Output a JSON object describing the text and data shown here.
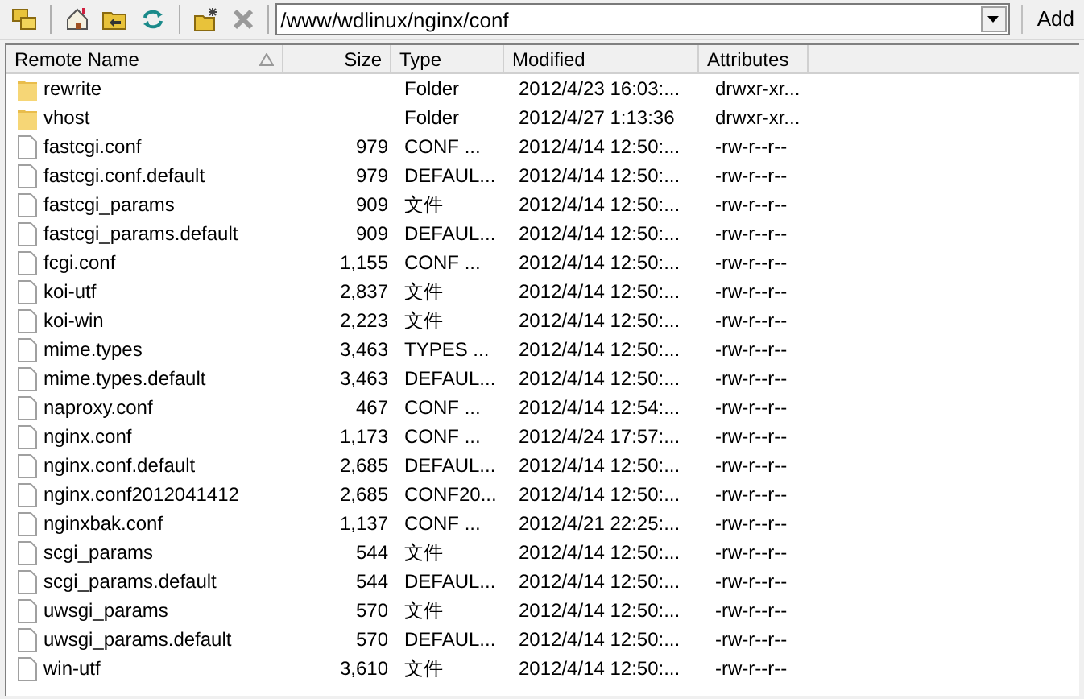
{
  "toolbar": {
    "path": "/www/wdlinux/nginx/conf",
    "add_label": "Add"
  },
  "table": {
    "columns": [
      {
        "label": "Remote Name",
        "sorted": true
      },
      {
        "label": "Size",
        "sorted": false
      },
      {
        "label": "Type",
        "sorted": false
      },
      {
        "label": "Modified",
        "sorted": false
      },
      {
        "label": "Attributes",
        "sorted": false
      }
    ],
    "rows": [
      {
        "kind": "folder",
        "name": "rewrite",
        "size": "",
        "type": "Folder",
        "modified": "2012/4/23 16:03:...",
        "attributes": "drwxr-xr..."
      },
      {
        "kind": "folder",
        "name": "vhost",
        "size": "",
        "type": "Folder",
        "modified": "2012/4/27 1:13:36",
        "attributes": "drwxr-xr..."
      },
      {
        "kind": "file",
        "name": "fastcgi.conf",
        "size": "979",
        "type": "CONF ...",
        "modified": "2012/4/14 12:50:...",
        "attributes": "-rw-r--r--"
      },
      {
        "kind": "file",
        "name": "fastcgi.conf.default",
        "size": "979",
        "type": "DEFAUL...",
        "modified": "2012/4/14 12:50:...",
        "attributes": "-rw-r--r--"
      },
      {
        "kind": "file",
        "name": "fastcgi_params",
        "size": "909",
        "type": "文件",
        "modified": "2012/4/14 12:50:...",
        "attributes": "-rw-r--r--"
      },
      {
        "kind": "file",
        "name": "fastcgi_params.default",
        "size": "909",
        "type": "DEFAUL...",
        "modified": "2012/4/14 12:50:...",
        "attributes": "-rw-r--r--"
      },
      {
        "kind": "file",
        "name": "fcgi.conf",
        "size": "1,155",
        "type": "CONF ...",
        "modified": "2012/4/14 12:50:...",
        "attributes": "-rw-r--r--"
      },
      {
        "kind": "file",
        "name": "koi-utf",
        "size": "2,837",
        "type": "文件",
        "modified": "2012/4/14 12:50:...",
        "attributes": "-rw-r--r--"
      },
      {
        "kind": "file",
        "name": "koi-win",
        "size": "2,223",
        "type": "文件",
        "modified": "2012/4/14 12:50:...",
        "attributes": "-rw-r--r--"
      },
      {
        "kind": "file",
        "name": "mime.types",
        "size": "3,463",
        "type": "TYPES ...",
        "modified": "2012/4/14 12:50:...",
        "attributes": "-rw-r--r--"
      },
      {
        "kind": "file",
        "name": "mime.types.default",
        "size": "3,463",
        "type": "DEFAUL...",
        "modified": "2012/4/14 12:50:...",
        "attributes": "-rw-r--r--"
      },
      {
        "kind": "file",
        "name": "naproxy.conf",
        "size": "467",
        "type": "CONF ...",
        "modified": "2012/4/14 12:54:...",
        "attributes": "-rw-r--r--"
      },
      {
        "kind": "file",
        "name": "nginx.conf",
        "size": "1,173",
        "type": "CONF ...",
        "modified": "2012/4/24 17:57:...",
        "attributes": "-rw-r--r--"
      },
      {
        "kind": "file",
        "name": "nginx.conf.default",
        "size": "2,685",
        "type": "DEFAUL...",
        "modified": "2012/4/14 12:50:...",
        "attributes": "-rw-r--r--"
      },
      {
        "kind": "file",
        "name": "nginx.conf2012041412",
        "size": "2,685",
        "type": "CONF20...",
        "modified": "2012/4/14 12:50:...",
        "attributes": "-rw-r--r--"
      },
      {
        "kind": "file",
        "name": "nginxbak.conf",
        "size": "1,137",
        "type": "CONF ...",
        "modified": "2012/4/21 22:25:...",
        "attributes": "-rw-r--r--"
      },
      {
        "kind": "file",
        "name": "scgi_params",
        "size": "544",
        "type": "文件",
        "modified": "2012/4/14 12:50:...",
        "attributes": "-rw-r--r--"
      },
      {
        "kind": "file",
        "name": "scgi_params.default",
        "size": "544",
        "type": "DEFAUL...",
        "modified": "2012/4/14 12:50:...",
        "attributes": "-rw-r--r--"
      },
      {
        "kind": "file",
        "name": "uwsgi_params",
        "size": "570",
        "type": "文件",
        "modified": "2012/4/14 12:50:...",
        "attributes": "-rw-r--r--"
      },
      {
        "kind": "file",
        "name": "uwsgi_params.default",
        "size": "570",
        "type": "DEFAUL...",
        "modified": "2012/4/14 12:50:...",
        "attributes": "-rw-r--r--"
      },
      {
        "kind": "file",
        "name": "win-utf",
        "size": "3,610",
        "type": "文件",
        "modified": "2012/4/14 12:50:...",
        "attributes": "-rw-r--r--"
      }
    ]
  }
}
